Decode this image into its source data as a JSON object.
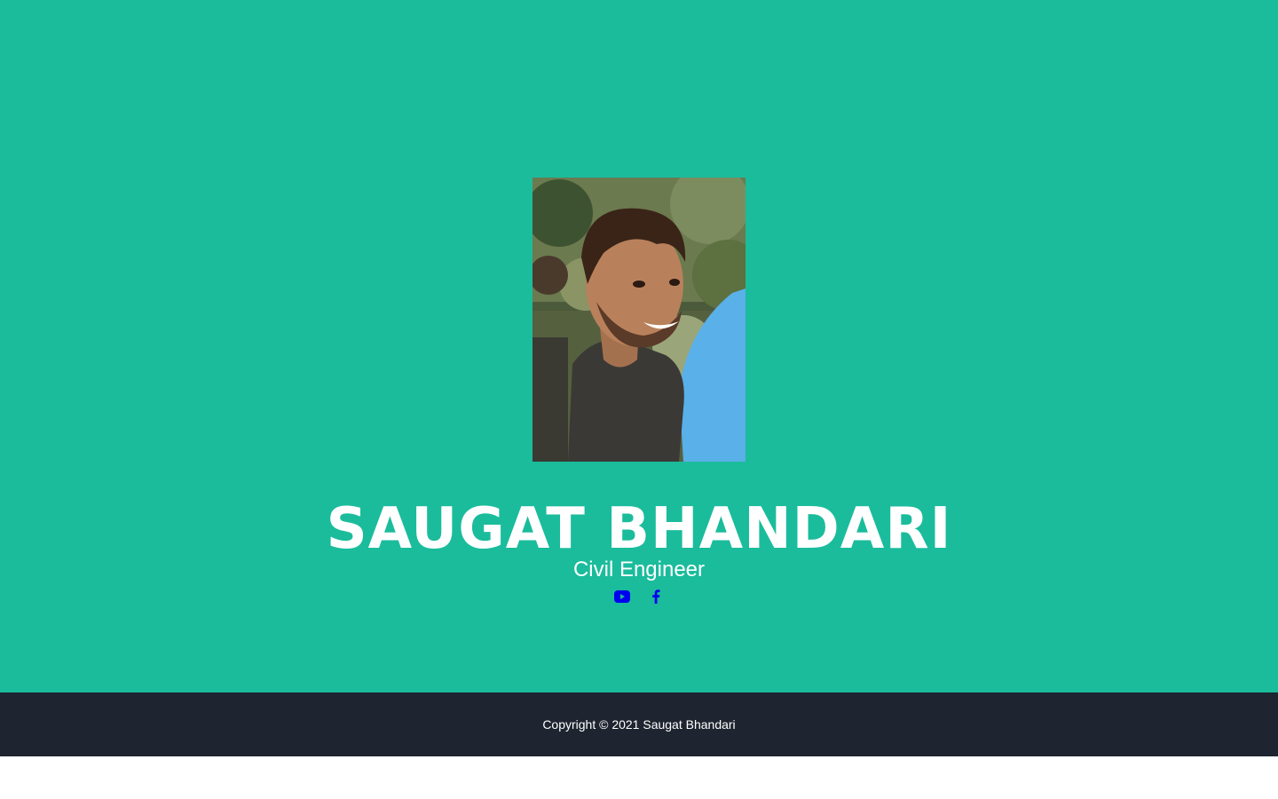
{
  "colors": {
    "hero_background": "#1abc9c",
    "footer_background": "#1e2530",
    "text": "#ffffff",
    "social_icon": "#0000ee"
  },
  "profile": {
    "name": "SAUGAT BHANDARI",
    "role": "Civil Engineer"
  },
  "social_links": [
    {
      "icon": "youtube-icon"
    },
    {
      "icon": "facebook-icon"
    }
  ],
  "footer": {
    "copyright": "Copyright © 2021 Saugat Bhandari"
  }
}
